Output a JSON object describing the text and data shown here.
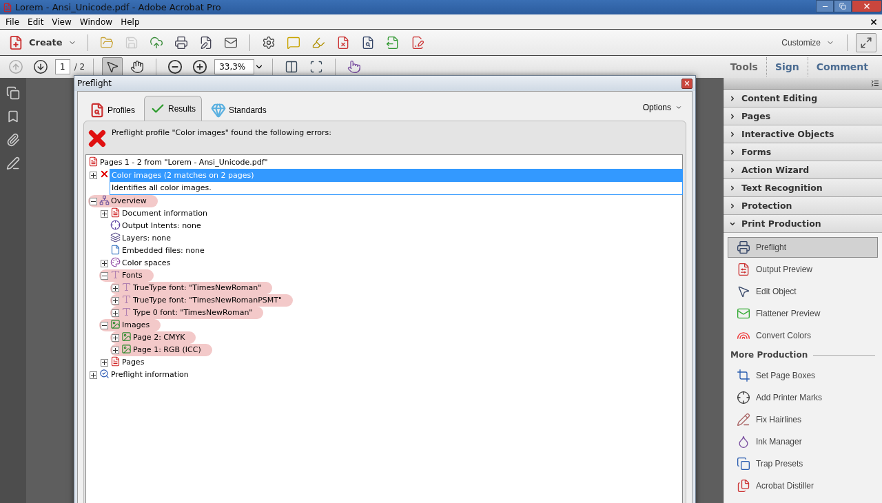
{
  "window": {
    "title": "Lorem - Ansi_Unicode.pdf - Adobe Acrobat Pro"
  },
  "menu": [
    "File",
    "Edit",
    "View",
    "Window",
    "Help"
  ],
  "toolbar": {
    "create": "Create",
    "buttons": [
      {
        "kind": "open",
        "disabled": false
      },
      {
        "kind": "save",
        "disabled": true
      },
      {
        "kind": "upload",
        "disabled": false
      },
      {
        "kind": "print",
        "disabled": false
      },
      {
        "kind": "edit",
        "disabled": false
      },
      {
        "kind": "mail",
        "disabled": false
      },
      {
        "kind": "settings",
        "disabled": false
      },
      {
        "kind": "comment",
        "disabled": false
      },
      {
        "kind": "highlight",
        "disabled": false
      },
      {
        "kind": "delete-page",
        "disabled": false
      },
      {
        "kind": "search-page",
        "disabled": false
      },
      {
        "kind": "export-page",
        "disabled": false
      },
      {
        "kind": "sign-page",
        "disabled": false
      }
    ],
    "customize": "Customize"
  },
  "nav_toolbar": {
    "buttons": [
      {
        "kind": "prev",
        "disabled": true,
        "selected": false
      },
      {
        "kind": "next",
        "disabled": false,
        "selected": false
      }
    ],
    "page": "1",
    "page_total": "/ 2",
    "tools": [
      {
        "kind": "select",
        "selected": true
      },
      {
        "kind": "hand",
        "selected": false
      }
    ],
    "zoom": "33,3%",
    "view_tools": [
      {
        "kind": "fit-width"
      },
      {
        "kind": "fit-page"
      },
      {
        "kind": "touch"
      }
    ],
    "panes": [
      "Tools",
      "Sign",
      "Comment"
    ]
  },
  "left_nav": [
    {
      "kind": "pages"
    },
    {
      "kind": "bookmark"
    },
    {
      "kind": "attachment"
    },
    {
      "kind": "signature"
    }
  ],
  "dialog": {
    "title": "Preflight",
    "tabs": [
      {
        "label": "Profiles",
        "kind": "profiles",
        "selected": false
      },
      {
        "label": "Results",
        "kind": "results",
        "selected": true
      },
      {
        "label": "Standards",
        "kind": "standards",
        "selected": false
      }
    ],
    "options": "Options",
    "message": "Preflight profile \"Color images\" found the following errors:",
    "tree": {
      "root": {
        "label": "Pages 1 - 2 from \"Lorem - Ansi_Unicode.pdf\"",
        "kind": "pdf"
      },
      "items": [
        {
          "label": "Color images (2 matches on 2 pages)",
          "kind": "error",
          "expanded": false,
          "selected": true,
          "description": "Identifies all color images."
        },
        {
          "label": "Overview",
          "kind": "overview",
          "expanded": true,
          "selected": false,
          "highlighted": true,
          "children": [
            {
              "label": "Document information",
              "kind": "pdf",
              "expanded": false,
              "selected": false,
              "highlighted": false
            },
            {
              "label": "Output Intents: none",
              "kind": "output",
              "selected": false,
              "highlighted": false
            },
            {
              "label": "Layers: none",
              "kind": "layers",
              "selected": false,
              "highlighted": false
            },
            {
              "label": "Embedded files: none",
              "kind": "file",
              "selected": false,
              "highlighted": false
            },
            {
              "label": "Color spaces",
              "kind": "colorspace",
              "expanded": false,
              "selected": false,
              "highlighted": false
            },
            {
              "label": "Fonts",
              "kind": "font",
              "expanded": true,
              "selected": false,
              "highlighted": true,
              "children": [
                {
                  "label": "TrueType font: \"TimesNewRoman\"",
                  "kind": "font",
                  "expanded": false,
                  "selected": false,
                  "highlighted": true
                },
                {
                  "label": "TrueType font: \"TimesNewRomanPSMT\"",
                  "kind": "font",
                  "expanded": false,
                  "selected": false,
                  "highlighted": true
                },
                {
                  "label": "Type 0 font: \"TimesNewRoman\"",
                  "kind": "font",
                  "expanded": false,
                  "selected": false,
                  "highlighted": true
                }
              ]
            },
            {
              "label": "Images",
              "kind": "image",
              "expanded": true,
              "selected": false,
              "highlighted": true,
              "children": [
                {
                  "label": "Page 2: CMYK",
                  "kind": "image",
                  "expanded": false,
                  "selected": false,
                  "highlighted": true
                },
                {
                  "label": "Page 1: RGB (ICC)",
                  "kind": "image",
                  "expanded": false,
                  "selected": false,
                  "highlighted": true
                }
              ]
            },
            {
              "label": "Pages",
              "kind": "pdf",
              "expanded": false,
              "selected": false,
              "highlighted": false
            }
          ]
        },
        {
          "label": "Preflight information",
          "kind": "info",
          "expanded": false,
          "selected": false,
          "highlighted": false
        }
      ]
    }
  },
  "right_panel": {
    "sections": [
      {
        "label": "Content Editing",
        "expanded": false
      },
      {
        "label": "Pages",
        "expanded": false
      },
      {
        "label": "Interactive Objects",
        "expanded": false
      },
      {
        "label": "Forms",
        "expanded": false
      },
      {
        "label": "Action Wizard",
        "expanded": false
      },
      {
        "label": "Text Recognition",
        "expanded": false
      },
      {
        "label": "Protection",
        "expanded": false
      },
      {
        "label": "Print Production",
        "expanded": true,
        "tools": [
          {
            "label": "Preflight",
            "kind": "preflight",
            "selected": true
          },
          {
            "label": "Output Preview",
            "kind": "output",
            "selected": false
          },
          {
            "label": "Edit Object",
            "kind": "cursor",
            "selected": false
          },
          {
            "label": "Flattener Preview",
            "kind": "flatten",
            "selected": false
          },
          {
            "label": "Convert Colors",
            "kind": "colors",
            "selected": false
          }
        ],
        "group": "More Production",
        "more_tools": [
          {
            "label": "Set Page Boxes",
            "kind": "crop",
            "selected": false
          },
          {
            "label": "Add Printer Marks",
            "kind": "marks",
            "selected": false
          },
          {
            "label": "Fix Hairlines",
            "kind": "pencil",
            "selected": false
          },
          {
            "label": "Ink Manager",
            "kind": "ink",
            "selected": false
          },
          {
            "label": "Trap Presets",
            "kind": "trap",
            "selected": false
          },
          {
            "label": "Acrobat Distiller",
            "kind": "distiller",
            "selected": false
          }
        ]
      }
    ]
  }
}
